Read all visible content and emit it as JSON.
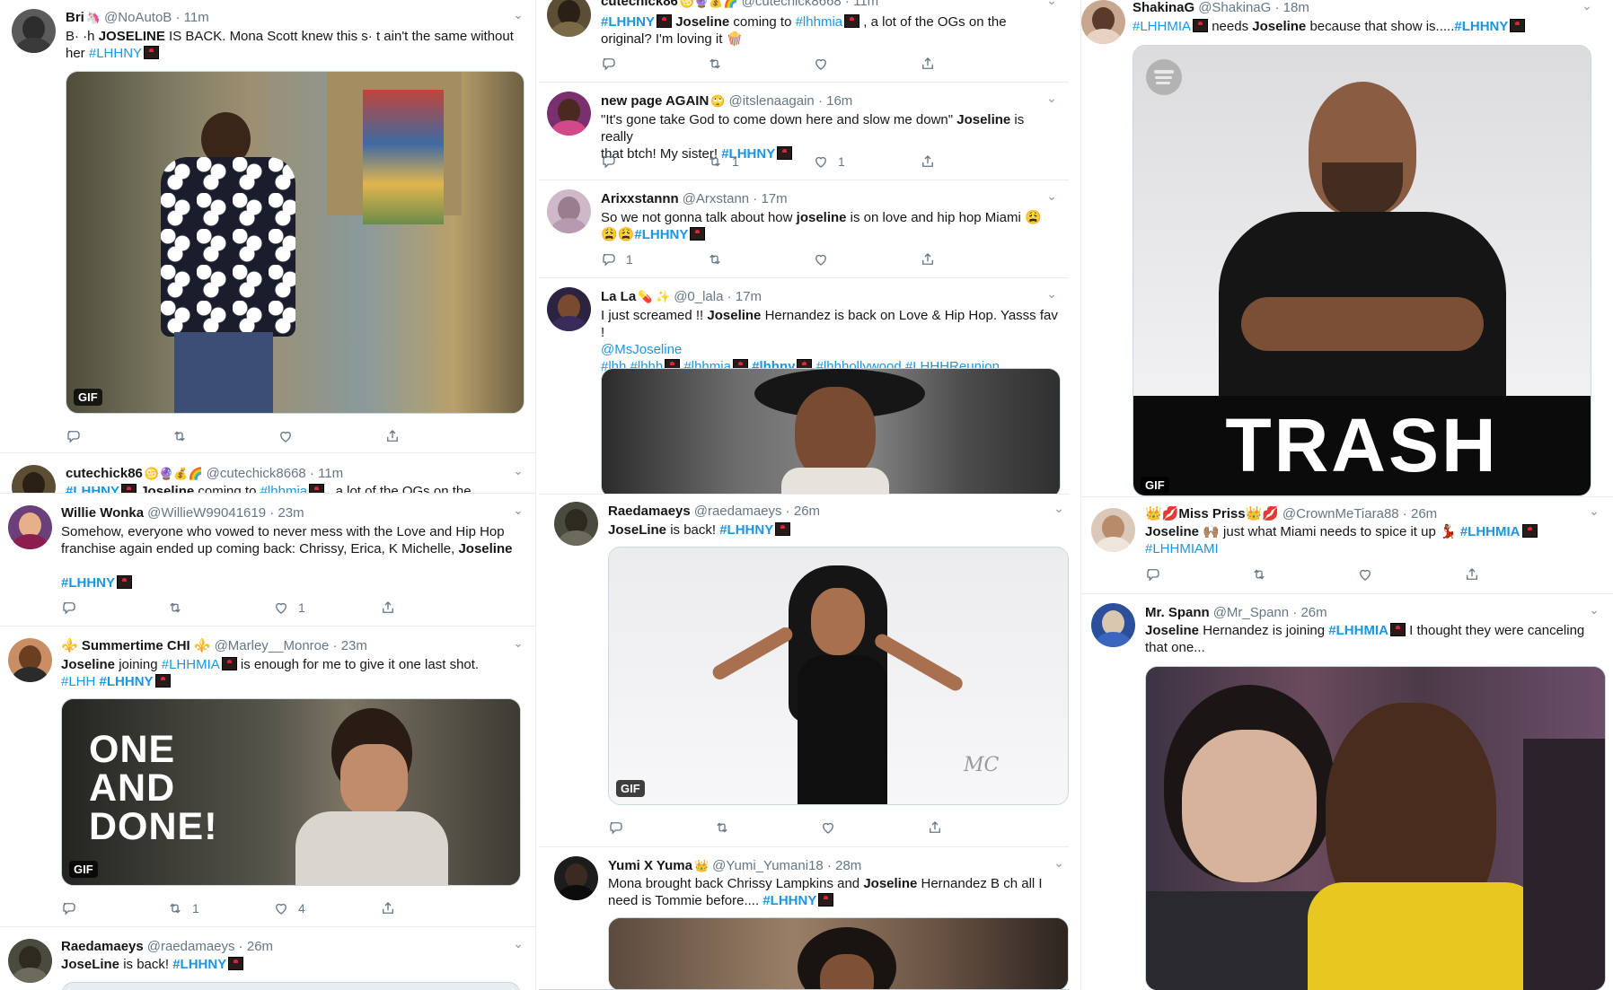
{
  "columns": {
    "left": [
      {
        "name": "Bri",
        "emoji": "🦄",
        "handle": "@NoAutoB",
        "time": "11m",
        "text_lines": [
          [
            "B·  ·h ",
            {
              "b": "JOSELINE"
            },
            " IS BACK. Mona Scott knew this s·  t ain't the same without"
          ],
          [
            "her  ",
            {
              "tag": "#LHHNY"
            },
            {
              "logo": true
            }
          ]
        ],
        "media": {
          "gif": "GIF"
        },
        "stats": {
          "reply": "",
          "retweet": "",
          "like": ""
        }
      },
      {
        "name": "cutechick86",
        "emoji": "♋🔮💰🌈",
        "handle": "@cutechick8668",
        "time": "11m",
        "text_lines": [
          [
            {
              "tagb": "#LHHNY"
            },
            {
              "logo": true
            },
            " ",
            {
              "b": "Joseline"
            },
            " coming to ",
            {
              "tag": "#lhhmia"
            },
            {
              "logo": true
            },
            " , a lot of the OGs on the"
          ]
        ]
      },
      {
        "name": "Willie Wonka",
        "emoji": "",
        "handle": "@WillieW99041619",
        "time": "23m",
        "text_lines": [
          [
            "Somehow, everyone who vowed to never mess with the Love and Hip Hop"
          ],
          [
            "franchise again ended up coming back: Chrissy, Erica, K Michelle, ",
            {
              "b": "Joseline"
            }
          ],
          [
            ""
          ],
          [
            {
              "tagb": "#LHHNY"
            },
            {
              "logo": true
            }
          ]
        ],
        "stats": {
          "reply": "",
          "retweet": "",
          "like": "1"
        }
      },
      {
        "name": "⚜️ Summertime CHI ⚜️",
        "emoji": "",
        "handle": "@Marley__Monroe",
        "time": "23m",
        "text_lines": [
          [
            {
              "b": "Joseline"
            },
            " joining ",
            {
              "tag": "#LHHMIA"
            },
            {
              "logo": true
            },
            " is enough for me to give it one last shot."
          ],
          [
            {
              "tag": "#LHH"
            },
            " ",
            {
              "tagb": "#LHHNY"
            },
            {
              "logo": true
            }
          ]
        ],
        "media": {
          "gif": "GIF",
          "caption": [
            "ONE",
            "AND",
            "DONE!"
          ]
        },
        "stats": {
          "reply": "",
          "retweet": "1",
          "like": "4"
        }
      },
      {
        "name": "Raedamaeys",
        "emoji": "",
        "handle": "@raedamaeys",
        "time": "26m",
        "text_lines": [
          [
            {
              "b": "JoseLine"
            },
            " is back!  ",
            {
              "tagb": "#LHHNY"
            },
            {
              "logo": true
            }
          ]
        ]
      }
    ],
    "middle": [
      {
        "name": "cutechick86",
        "emoji": "♋🔮💰🌈",
        "handle": "@cutechick8668",
        "time": "11m",
        "text_lines": [
          [
            {
              "tagb": "#LHHNY"
            },
            {
              "logo": true
            },
            " ",
            {
              "b": "Joseline"
            },
            " coming to ",
            {
              "tag": "#lhhmia"
            },
            {
              "logo": true
            },
            " , a lot of the OGs on the"
          ],
          [
            "original? I'm loving it 🍿"
          ]
        ],
        "stats": {
          "reply": "",
          "retweet": "",
          "like": ""
        }
      },
      {
        "name": "new page AGAIN",
        "emoji": "🙄",
        "handle": "@itslenaagain",
        "time": "16m",
        "text_lines": [
          [
            "\"It's gone take God to come down here and slow me down\" ",
            {
              "b": "Joseline"
            },
            " is really"
          ],
          [
            "that btch! My sister! ",
            {
              "tagb": "#LHHNY"
            },
            {
              "logo": true
            }
          ]
        ],
        "stats": {
          "reply": "",
          "retweet": "1",
          "like": "1"
        }
      },
      {
        "name": "Arixxstannn",
        "emoji": "",
        "handle": "@Arxstann",
        "time": "17m",
        "text_lines": [
          [
            "So we not gonna talk about how ",
            {
              "b": "joseline"
            },
            " is on love and hip hop Miami 😩"
          ],
          [
            "😩😩",
            {
              "tagb": "#LHHNY"
            },
            {
              "logo": true
            }
          ]
        ],
        "stats": {
          "reply": "1",
          "retweet": "",
          "like": ""
        }
      },
      {
        "name": "La La",
        "emoji": "💊 ✨",
        "handle": "@0_lala",
        "time": "17m",
        "text_lines": [
          [
            "I just screamed !! ",
            {
              "b": "Joseline"
            },
            " Hernandez is back on Love & Hip Hop. Yasss fav !"
          ],
          [
            {
              "tag": "@MsJoseline"
            }
          ],
          [
            {
              "tag": "#lhh"
            },
            " ",
            {
              "tag": "#lhhh"
            },
            {
              "logo": true
            },
            "  ",
            {
              "tag": "#lhhmia"
            },
            {
              "logo": true
            },
            "  ",
            {
              "tagb": "#lhhny"
            },
            {
              "logo": true
            },
            "  ",
            {
              "tag": "#lhhhollywood"
            },
            " ",
            {
              "tag": "#LHHHReunion"
            }
          ]
        ]
      },
      {
        "name": "Raedamaeys",
        "emoji": "",
        "handle": "@raedamaeys",
        "time": "26m",
        "text_lines": [
          [
            {
              "b": "JoseLine"
            },
            " is back!  ",
            {
              "tagb": "#LHHNY"
            },
            {
              "logo": true
            }
          ]
        ],
        "media": {
          "gif": "GIF",
          "watermark": "MC"
        },
        "stats": {
          "reply": "",
          "retweet": "",
          "like": ""
        }
      },
      {
        "name": "Yumi X Yuma",
        "emoji": "👑",
        "handle": "@Yumi_Yumani18",
        "time": "28m",
        "text_lines": [
          [
            "Mona brought back Chrissy Lampkins and ",
            {
              "b": "Joseline"
            },
            " Hernandez B   ch all I"
          ],
          [
            "need is Tommie before.... ",
            {
              "tagb": "#LHHNY"
            },
            {
              "logo": true
            }
          ]
        ]
      }
    ],
    "right": [
      {
        "name": "ShakinaG",
        "emoji": "",
        "handle": "@ShakinaG",
        "time": "18m",
        "text_lines": [
          [
            {
              "tag": "#LHHMIA"
            },
            {
              "logo": true
            },
            " needs ",
            {
              "b": "Joseline"
            },
            " because that show is.....",
            {
              "tagb": "#LHHNY"
            },
            {
              "logo": true
            }
          ]
        ],
        "media": {
          "gif": "GIF",
          "caption": [
            "TRASH"
          ]
        }
      },
      {
        "name": "👑💋Miss Priss👑💋",
        "emoji": "",
        "handle": "@CrownMeTiara88",
        "time": "26m",
        "text_lines": [
          [
            {
              "b": "Joseline"
            },
            " 🙌🏽 just what Miami needs to spice it up 💃🏽 ",
            {
              "tagb": "#LHHMIA"
            },
            {
              "logo": true
            }
          ],
          [
            {
              "tag": "#LHHMIAMI"
            }
          ]
        ],
        "stats": {
          "reply": "",
          "retweet": "",
          "like": ""
        }
      },
      {
        "name": "Mr. Spann",
        "emoji": "",
        "handle": "@Mr_Spann",
        "time": "26m",
        "text_lines": [
          [
            {
              "b": "Joseline"
            },
            " Hernandez is joining ",
            {
              "tagb": "#LHHMIA"
            },
            {
              "logo": true
            },
            " I thought they were canceling"
          ],
          [
            "that one..."
          ]
        ]
      }
    ]
  },
  "colors": {
    "link": "#1b95e0",
    "text": "#14171a",
    "muted": "#657786",
    "border": "#e6ecf0"
  },
  "icons": {
    "reply": "reply-icon",
    "retweet": "retweet-icon",
    "like": "heart-icon",
    "share": "share-icon",
    "caret": "chevron-down-icon"
  }
}
